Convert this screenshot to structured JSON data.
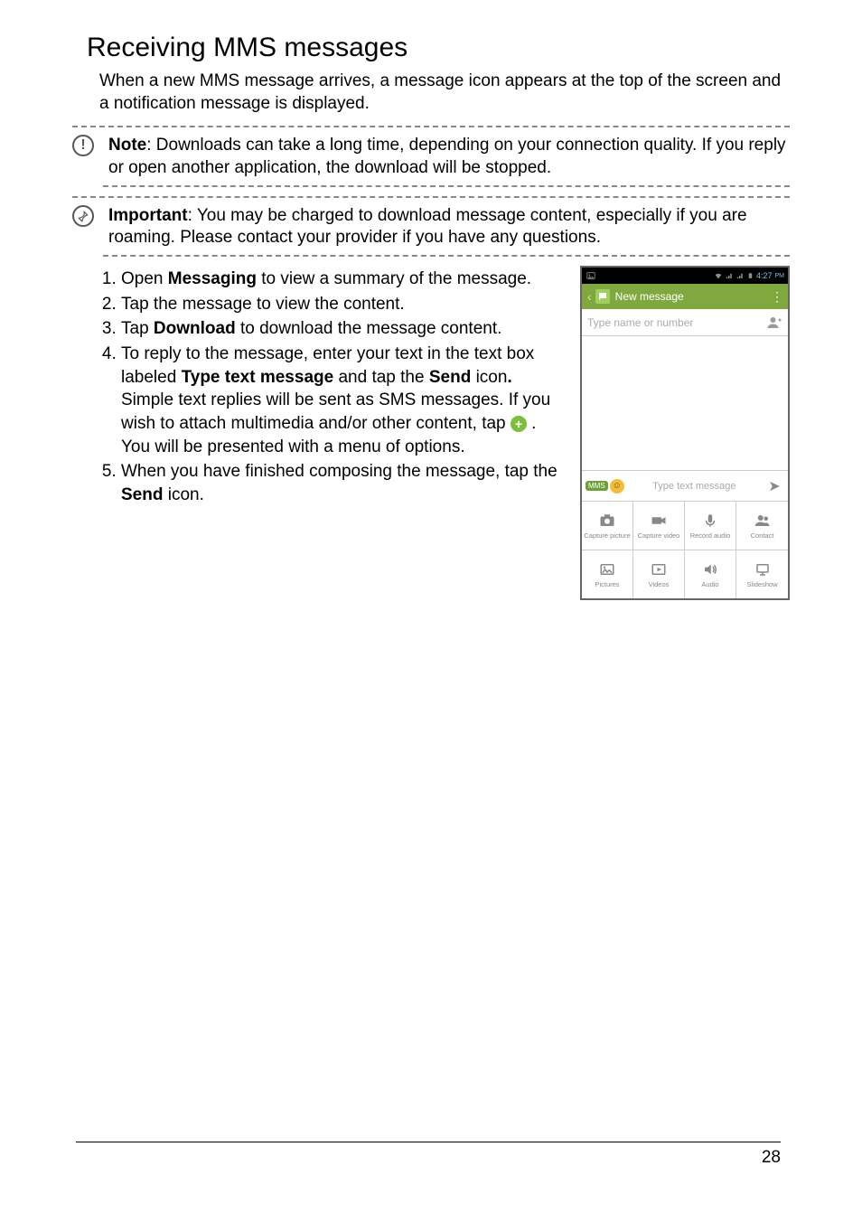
{
  "title": "Receiving MMS messages",
  "intro": "When a new MMS message arrives, a message icon appears at the top of the screen and a notification message is displayed.",
  "note": {
    "label": "Note",
    "body_after": ": Downloads can take a long time, depending on your connection quality. If you reply or open another application, the download will be stopped."
  },
  "important": {
    "label": "Important",
    "body_after": ": You may be charged to download message content, especially if you are roaming. Please contact your provider if you have any questions."
  },
  "steps": {
    "s1_a": "Open ",
    "s1_b": "Messaging",
    "s1_c": " to view a summary of the message.",
    "s2": "Tap the message to view the content.",
    "s3_a": "Tap ",
    "s3_b": "Download",
    "s3_c": " to download the message content.",
    "s4_a": "To reply to the message, enter your text in the text box labeled ",
    "s4_b": "Type text message",
    "s4_c": " and tap the ",
    "s4_d": "Send",
    "s4_e": " icon",
    "s4_f": ".",
    "s4_g": " Simple text replies will be sent as SMS messages. If you wish to attach multimedia and/or other content, tap ",
    "s4_h": " . You will be presented with a menu of options.",
    "s5_a": "When you have finished composing the message, tap the ",
    "s5_b": "Send",
    "s5_c": " icon."
  },
  "phone": {
    "statusbar_time": "4:27",
    "statusbar_pm": "PM",
    "navbar_title": "New message",
    "recipient_placeholder": "Type name or number",
    "input_placeholder": "Type text message",
    "mms_badge": "MMS",
    "attachments": {
      "capture_picture": "Capture picture",
      "capture_video": "Capture video",
      "record_audio": "Record audio",
      "contact": "Contact",
      "pictures": "Pictures",
      "videos": "Videos",
      "audio": "Audio",
      "slideshow": "Slideshow"
    }
  },
  "page_number": "28"
}
